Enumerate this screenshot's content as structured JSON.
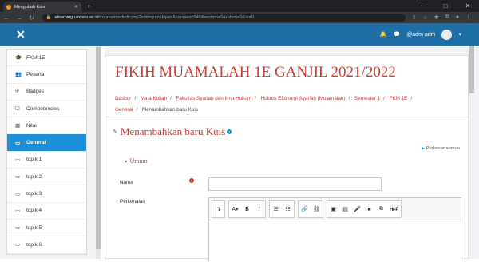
{
  "browser": {
    "tab_title": "Mengubah Kuis",
    "url_host": "elearning.uinsatu.ac.id",
    "url_path": "/course/modedit.php?add=quiz&type=&course=5946&section=0&return=0&sr=0"
  },
  "topnav": {
    "user_name": "@adm adm"
  },
  "sidebar": {
    "items": [
      {
        "label": "FKM 1E",
        "icon": "graduation-cap-icon"
      },
      {
        "label": "Peserta",
        "icon": "users-icon"
      },
      {
        "label": "Badges",
        "icon": "shield-icon"
      },
      {
        "label": "Competencies",
        "icon": "checklist-icon"
      },
      {
        "label": "Nilai",
        "icon": "table-icon"
      },
      {
        "label": "General",
        "icon": "folder-icon"
      },
      {
        "label": "topik 1",
        "icon": "folder-icon"
      },
      {
        "label": "topik 2",
        "icon": "folder-icon"
      },
      {
        "label": "topik 3",
        "icon": "folder-icon"
      },
      {
        "label": "topik 4",
        "icon": "folder-icon"
      },
      {
        "label": "topik 5",
        "icon": "folder-icon"
      },
      {
        "label": "topik 6",
        "icon": "folder-icon"
      }
    ],
    "active_index": 5
  },
  "header": {
    "course_title": "FIKIH MUAMALAH 1E GANJIL 2021/2022",
    "breadcrumb": [
      "Dasbor",
      "Mata Kuliah",
      "Fakultas Syariah dan Ilmu Hukum",
      "Hukum Ekonomi Syariah (Mu'amalah)",
      "Semester 1",
      "FKM 1E",
      "General",
      "Menambahkan baru Kuis"
    ]
  },
  "form": {
    "page_title": "Menambahkan baru Kuis",
    "expand_all": "Perbesar semua",
    "section_title": "Umum",
    "name_label": "Nama",
    "intro_label": "Perkenalan"
  },
  "colors": {
    "brand_blue": "#1d6fa5",
    "active_blue": "#1d8ed8",
    "title_red": "#c53d33"
  }
}
